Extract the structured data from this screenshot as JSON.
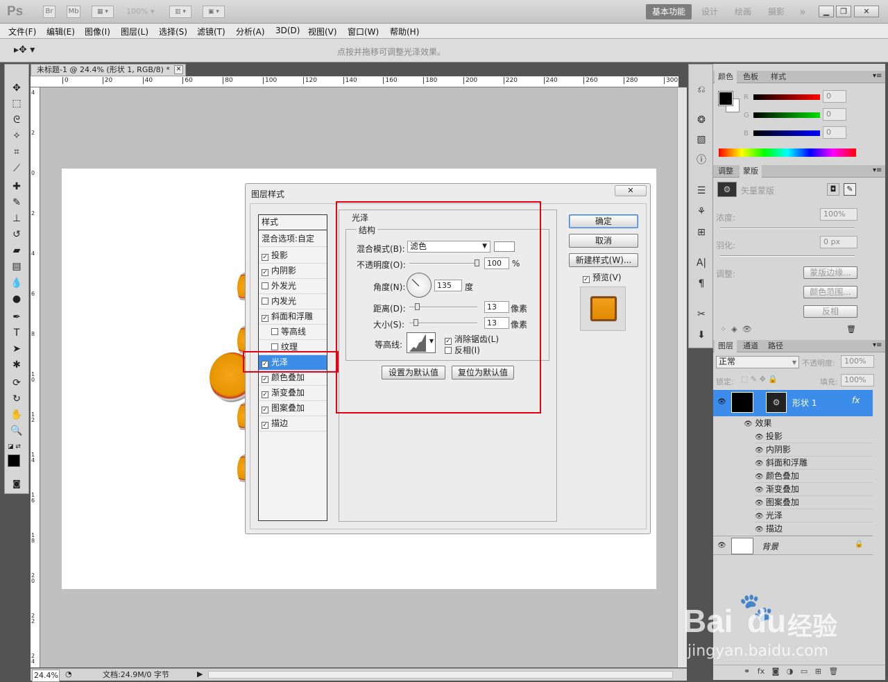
{
  "app": {
    "logo": "Ps",
    "bridge": "Br",
    "minibridge": "Mb",
    "zoom": "100%",
    "workspaces": [
      "基本功能",
      "设计",
      "绘画",
      "摄影"
    ],
    "more": "»"
  },
  "menu": [
    "文件(F)",
    "编辑(E)",
    "图像(I)",
    "图层(L)",
    "选择(S)",
    "滤镜(T)",
    "分析(A)",
    "3D(D)",
    "视图(V)",
    "窗口(W)",
    "帮助(H)"
  ],
  "options": {
    "hint": "点按并拖移可调整光泽效果。"
  },
  "document": {
    "tab_title": "未标题-1 @ 24.4% (形状 1, RGB/8) *",
    "ruler_top": [
      "0",
      "20",
      "40",
      "60",
      "80",
      "100",
      "120",
      "140",
      "160",
      "180",
      "200",
      "220",
      "240",
      "260",
      "280",
      "300"
    ],
    "ruler_left": [
      "4",
      "2",
      "0",
      "2",
      "4",
      "6",
      "8",
      "10",
      "12",
      "14",
      "16",
      "18",
      "20",
      "22",
      "24"
    ],
    "status_zoom": "24.4%",
    "status_doc": "文档:24.9M/0 字节"
  },
  "dialog": {
    "title": "图层样式",
    "style_header": "样式",
    "blend_header": "混合选项:自定",
    "styles": [
      {
        "label": "投影",
        "checked": true
      },
      {
        "label": "内阴影",
        "checked": true
      },
      {
        "label": "外发光",
        "checked": false
      },
      {
        "label": "内发光",
        "checked": false
      },
      {
        "label": "斜面和浮雕",
        "checked": true
      },
      {
        "label": "等高线",
        "checked": false
      },
      {
        "label": "纹理",
        "checked": false
      },
      {
        "label": "光泽",
        "checked": true
      },
      {
        "label": "颜色叠加",
        "checked": true
      },
      {
        "label": "渐变叠加",
        "checked": true
      },
      {
        "label": "图案叠加",
        "checked": true
      },
      {
        "label": "描边",
        "checked": true
      }
    ],
    "section_title": "光泽",
    "group_title": "结构",
    "blend_mode_label": "混合模式(B):",
    "blend_mode_value": "滤色",
    "opacity_label": "不透明度(O):",
    "opacity_value": "100",
    "opacity_unit": "%",
    "angle_label": "角度(N):",
    "angle_value": "135",
    "angle_unit": "度",
    "distance_label": "距离(D):",
    "distance_value": "13",
    "distance_unit": "像素",
    "size_label": "大小(S):",
    "size_value": "13",
    "size_unit": "像素",
    "contour_label": "等高线:",
    "antialias_label": "消除锯齿(L)",
    "invert_label": "反相(I)",
    "set_default": "设置为默认值",
    "reset_default": "复位为默认值",
    "ok": "确定",
    "cancel": "取消",
    "new_style": "新建样式(W)...",
    "preview": "预览(V)",
    "swatch_color": "#f0a01e"
  },
  "color_panel": {
    "tabs": [
      "颜色",
      "色板",
      "样式"
    ],
    "r_label": "R",
    "g_label": "G",
    "b_label": "B",
    "r": "0",
    "g": "0",
    "b": "0"
  },
  "mask_panel": {
    "tabs": [
      "调整",
      "蒙版"
    ],
    "vector_mask": "矢量蒙版",
    "density_label": "浓度:",
    "density_value": "100%",
    "feather_label": "羽化:",
    "feather_value": "0 px",
    "adjust_label": "调整:",
    "mask_edge": "蒙版边缘...",
    "color_range": "颜色范围...",
    "invert": "反相"
  },
  "layers_panel": {
    "tabs": [
      "图层",
      "通道",
      "路径"
    ],
    "blend": "正常",
    "opacity_label": "不透明度:",
    "opacity": "100%",
    "lock_label": "锁定:",
    "fill_label": "填充:",
    "fill": "100%",
    "layer_name": "形状 1",
    "fx": "fx",
    "effects_label": "效果",
    "effects": [
      "投影",
      "内阴影",
      "斜面和浮雕",
      "颜色叠加",
      "渐变叠加",
      "图案叠加",
      "光泽",
      "描边"
    ],
    "background": "背景"
  },
  "watermark": {
    "brand": "Bai",
    "brand2": "du",
    "cn": "经验",
    "url": "jingyan.baidu.com"
  },
  "colors": {
    "accent": "#3c8cea",
    "highlight_box": "#e60012",
    "orange": "#f0a01e"
  }
}
